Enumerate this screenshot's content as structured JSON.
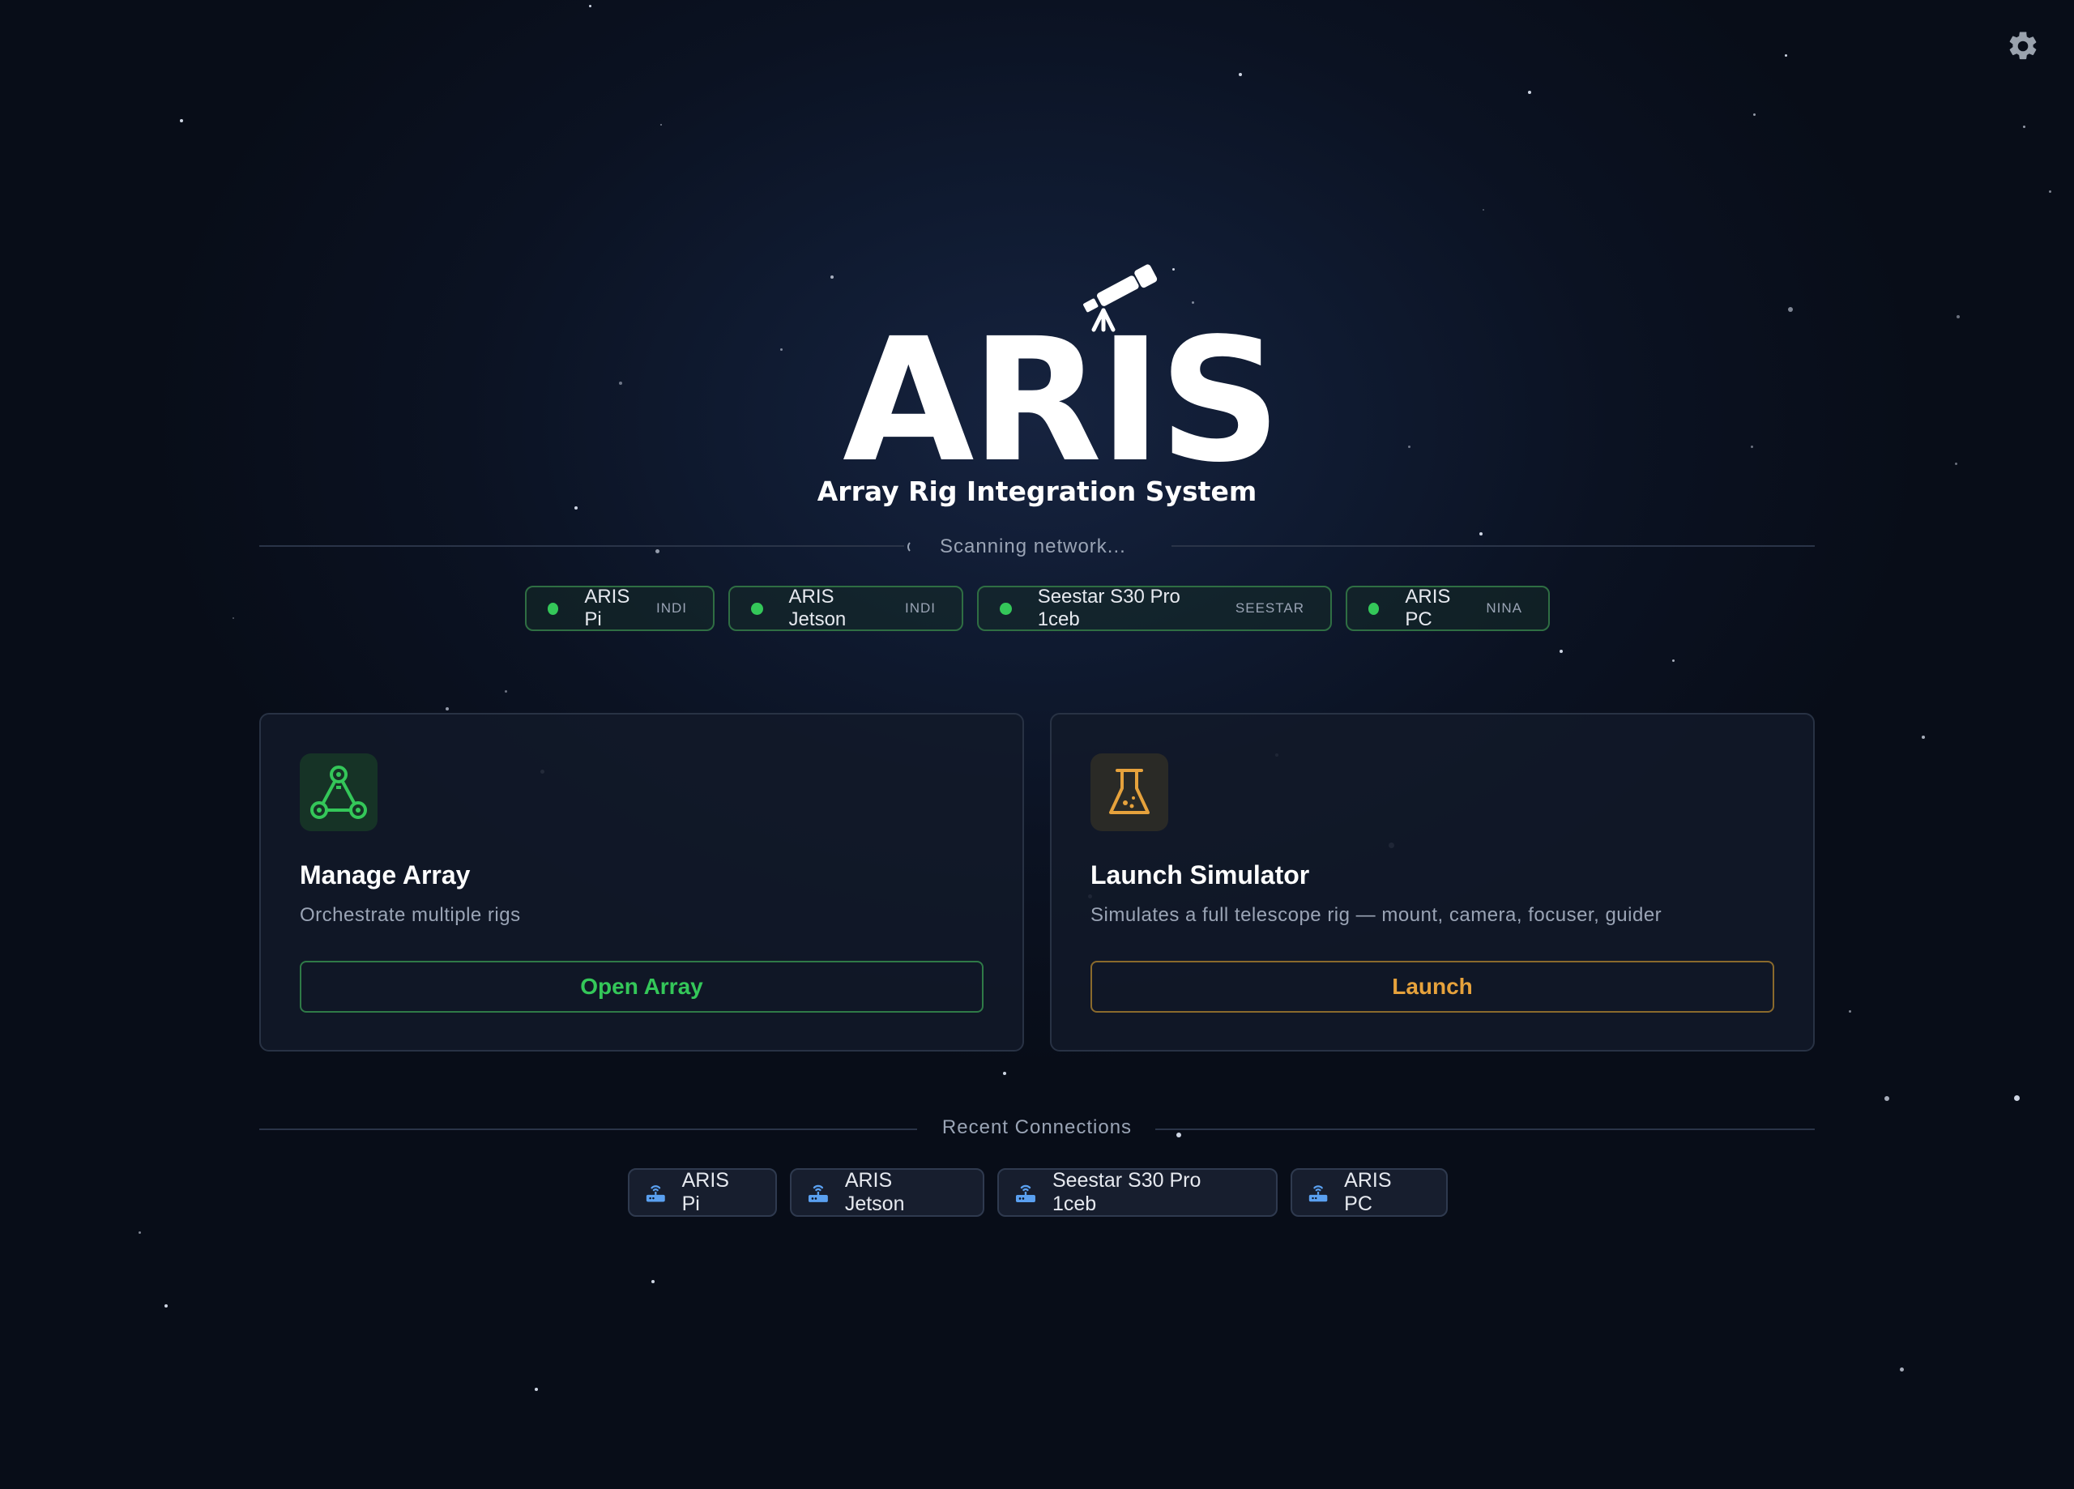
{
  "app": {
    "title": "ARIS",
    "subtitle": "Array Rig Integration System"
  },
  "settings": {
    "icon": "gear-icon"
  },
  "scan": {
    "status_text": "Scanning network..."
  },
  "discovered_devices": [
    {
      "name": "ARIS Pi",
      "type": "INDI",
      "status_color": "#34c759"
    },
    {
      "name": "ARIS Jetson",
      "type": "INDI",
      "status_color": "#34c759"
    },
    {
      "name": "Seestar S30 Pro 1ceb",
      "type": "SEESTAR",
      "status_color": "#34c759"
    },
    {
      "name": "ARIS PC",
      "type": "NINA",
      "status_color": "#34c759"
    }
  ],
  "cards": {
    "manage_array": {
      "icon": "network-graph-icon",
      "title": "Manage Array",
      "description": "Orchestrate multiple rigs",
      "button_label": "Open Array",
      "accent_color": "#34c759"
    },
    "launch_simulator": {
      "icon": "flask-icon",
      "title": "Launch Simulator",
      "description": "Simulates a full telescope rig — mount, camera, focuser, guider",
      "button_label": "Launch",
      "accent_color": "#e6a23c"
    }
  },
  "recent": {
    "label": "Recent Connections",
    "items": [
      {
        "name": "ARIS Pi",
        "icon": "router-icon"
      },
      {
        "name": "ARIS Jetson",
        "icon": "router-icon"
      },
      {
        "name": "Seestar S30 Pro 1ceb",
        "icon": "router-icon"
      },
      {
        "name": "ARIS PC",
        "icon": "router-icon"
      }
    ],
    "icon_color": "#5aa0f0"
  }
}
